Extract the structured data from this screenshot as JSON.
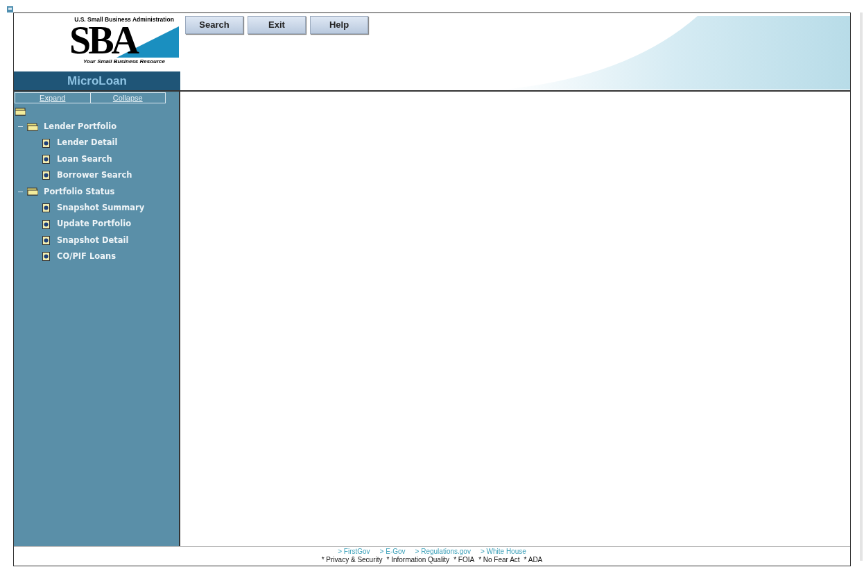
{
  "logo": {
    "agency": "U.S. Small Business Administration",
    "mark": "SBA",
    "tagline": "Your Small Business Resource"
  },
  "app_title": "MicroLoan",
  "toolbar": [
    "Search",
    "Exit",
    "Help"
  ],
  "tree_controls": [
    "Expand",
    "Collapse"
  ],
  "tree": [
    {
      "label": "Lender Portfolio",
      "expanded": true,
      "children": [
        {
          "label": "Lender Detail"
        },
        {
          "label": "Loan Search"
        },
        {
          "label": "Borrower Search"
        }
      ]
    },
    {
      "label": "Portfolio Status",
      "expanded": true,
      "children": [
        {
          "label": "Snapshot Summary"
        },
        {
          "label": "Update Portfolio"
        },
        {
          "label": "Snapshot Detail"
        },
        {
          "label": "CO/PIF Loans"
        }
      ]
    }
  ],
  "footer": {
    "links": [
      "> FirstGov",
      "> E-Gov",
      "> Regulations.gov",
      "> White House"
    ],
    "policies": [
      "* Privacy & Security",
      "* Information Quality",
      "* FOIA",
      "* No Fear Act",
      "* ADA"
    ]
  }
}
